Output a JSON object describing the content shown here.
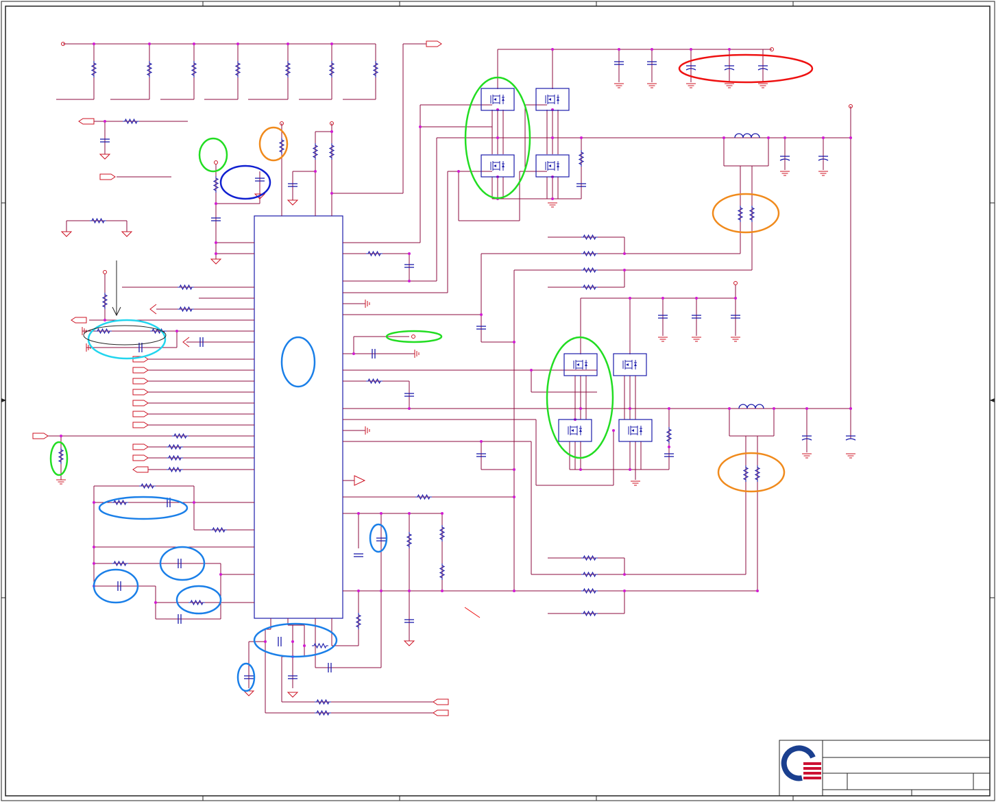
{
  "sheet": {
    "description_visible_text": "",
    "title_block": {
      "logo": "company-logo",
      "fields": []
    }
  },
  "colors": {
    "wire": "#8b0a3c",
    "wire_blue": "#1a1aaa",
    "component": "#cc1122",
    "component_blue": "#1a1aaa",
    "junction": "#d11ad1",
    "frame": "#222222",
    "highlight_green": "#22dd22",
    "highlight_orange": "#f08a1c",
    "highlight_blue": "#1a7fe8",
    "highlight_darkblue": "#1020d0",
    "highlight_cyan": "#22d5ee",
    "highlight_red": "#ee1111",
    "logo_blue": "#1a3f8f",
    "logo_red": "#cc1133"
  },
  "icons": [
    "resistor-icon",
    "capacitor-icon",
    "inductor-icon",
    "mosfet-icon",
    "ground-icon",
    "port-icon",
    "test-point-icon"
  ]
}
